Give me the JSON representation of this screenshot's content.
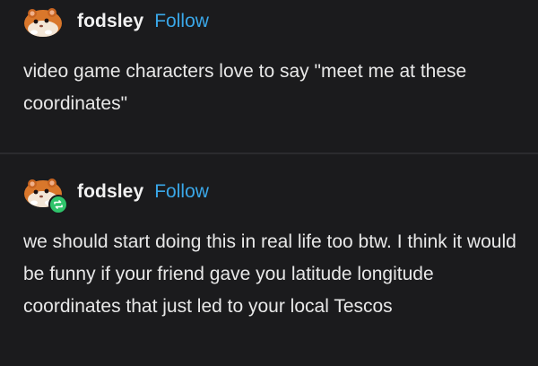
{
  "posts": [
    {
      "username": "fodsley",
      "follow_label": "Follow",
      "avatar_icon": "hamster-avatar-icon",
      "text": "video game characters love to say \"meet me at these coordinates\""
    },
    {
      "username": "fodsley",
      "follow_label": "Follow",
      "avatar_icon": "hamster-avatar-icon",
      "reblog_icon": "reblog-icon",
      "text": "we should start doing this in real life too btw. I think it would be funny if your friend gave you latitude longitude coordinates that just led to your local Tescos"
    }
  ],
  "colors": {
    "background": "#1b1b1d",
    "follow_link": "#3aa7e8",
    "reblog_badge": "#2fc46b"
  }
}
